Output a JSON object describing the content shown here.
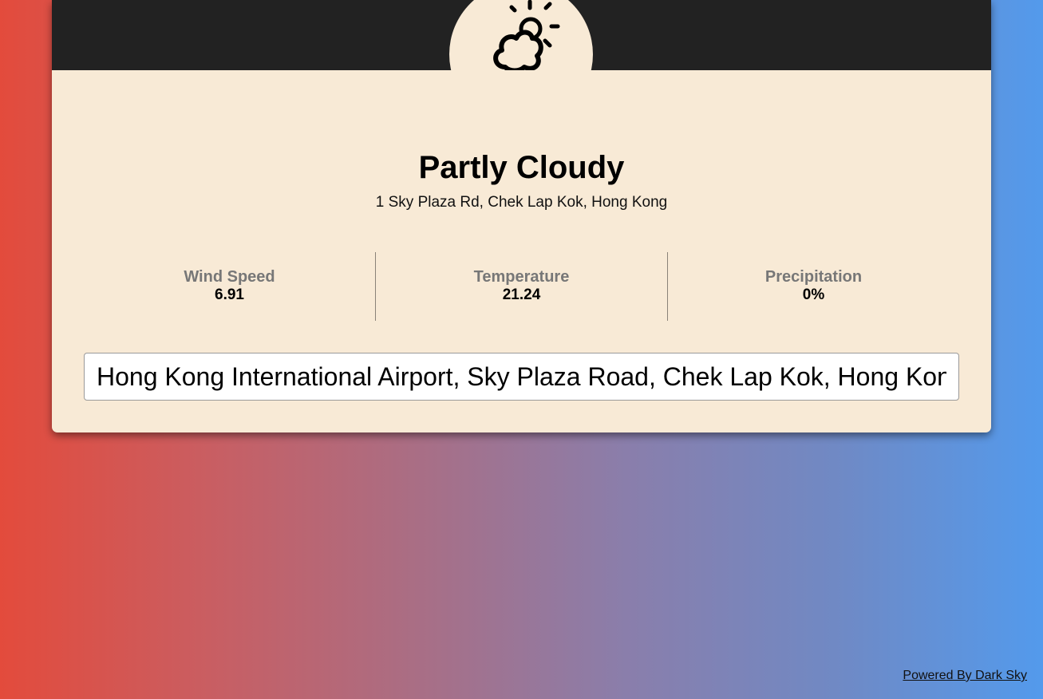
{
  "weather": {
    "icon": "partly-cloudy-day-icon",
    "summary": "Partly Cloudy",
    "address": "1 Sky Plaza Rd, Chek Lap Kok, Hong Kong"
  },
  "stats": [
    {
      "label": "Wind Speed",
      "value": "6.91"
    },
    {
      "label": "Temperature",
      "value": "21.24"
    },
    {
      "label": "Precipitation",
      "value": "0%"
    }
  ],
  "search": {
    "value": "Hong Kong International Airport, Sky Plaza Road, Chek Lap Kok, Hong Kong"
  },
  "footer": {
    "credit_label": "Powered By Dark Sky"
  },
  "colors": {
    "header": "#222222",
    "card": "#f8ead6",
    "gradient_left": "#e34b3c",
    "gradient_right": "#539aec"
  }
}
